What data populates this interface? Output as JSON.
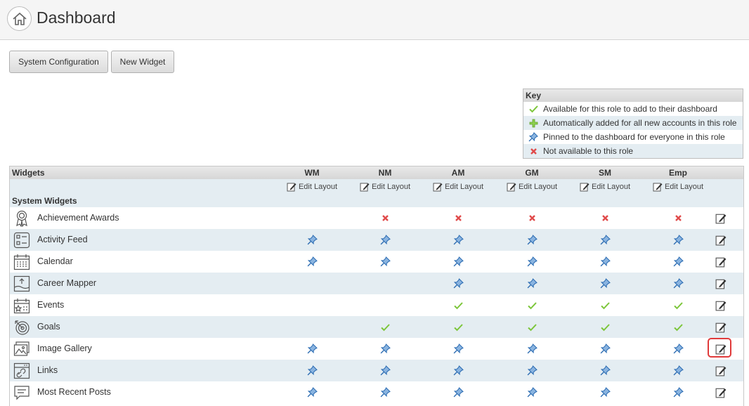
{
  "header": {
    "title": "Dashboard",
    "home_icon": "home-icon"
  },
  "toolbar": {
    "system_config_label": "System Configuration",
    "new_widget_label": "New Widget"
  },
  "key": {
    "title": "Key",
    "items": [
      {
        "icon": "check-icon",
        "label": "Available for this role to add to their dashboard"
      },
      {
        "icon": "plus-icon",
        "label": "Automatically added for all new accounts in this role"
      },
      {
        "icon": "pin-icon",
        "label": "Pinned to the dashboard for everyone in this role"
      },
      {
        "icon": "cross-icon",
        "label": "Not available to this role"
      }
    ]
  },
  "grid": {
    "widgets_header": "Widgets",
    "roles": [
      "WM",
      "NM",
      "AM",
      "GM",
      "SM",
      "Emp"
    ],
    "edit_layout_label": "Edit Layout",
    "section_title": "System Widgets",
    "rows": [
      {
        "name": "Achievement Awards",
        "icon": "award-icon",
        "states": [
          "",
          "cross",
          "cross",
          "cross",
          "cross",
          "cross"
        ]
      },
      {
        "name": "Activity Feed",
        "icon": "activity-feed-icon",
        "states": [
          "pin",
          "pin",
          "pin",
          "pin",
          "pin",
          "pin"
        ]
      },
      {
        "name": "Calendar",
        "icon": "calendar-icon",
        "states": [
          "pin",
          "pin",
          "pin",
          "pin",
          "pin",
          "pin"
        ]
      },
      {
        "name": "Career Mapper",
        "icon": "career-mapper-icon",
        "states": [
          "",
          "",
          "pin",
          "pin",
          "pin",
          "pin"
        ]
      },
      {
        "name": "Events",
        "icon": "events-icon",
        "states": [
          "",
          "",
          "check",
          "check",
          "check",
          "check"
        ]
      },
      {
        "name": "Goals",
        "icon": "target-icon",
        "states": [
          "",
          "check",
          "check",
          "check",
          "check",
          "check"
        ]
      },
      {
        "name": "Image Gallery",
        "icon": "image-gallery-icon",
        "states": [
          "pin",
          "pin",
          "pin",
          "pin",
          "pin",
          "pin"
        ]
      },
      {
        "name": "Links",
        "icon": "link-icon",
        "states": [
          "pin",
          "pin",
          "pin",
          "pin",
          "pin",
          "pin"
        ]
      },
      {
        "name": "Most Recent Posts",
        "icon": "posts-icon",
        "states": [
          "pin",
          "pin",
          "pin",
          "pin",
          "pin",
          "pin"
        ]
      }
    ],
    "highlighted_edit_row": "Image Gallery"
  },
  "colors": {
    "check": "#7cc63a",
    "cross": "#e04a4a",
    "pin": "#2d6db3",
    "highlight": "#e03a3a",
    "row_alt": "#e4edf2"
  }
}
